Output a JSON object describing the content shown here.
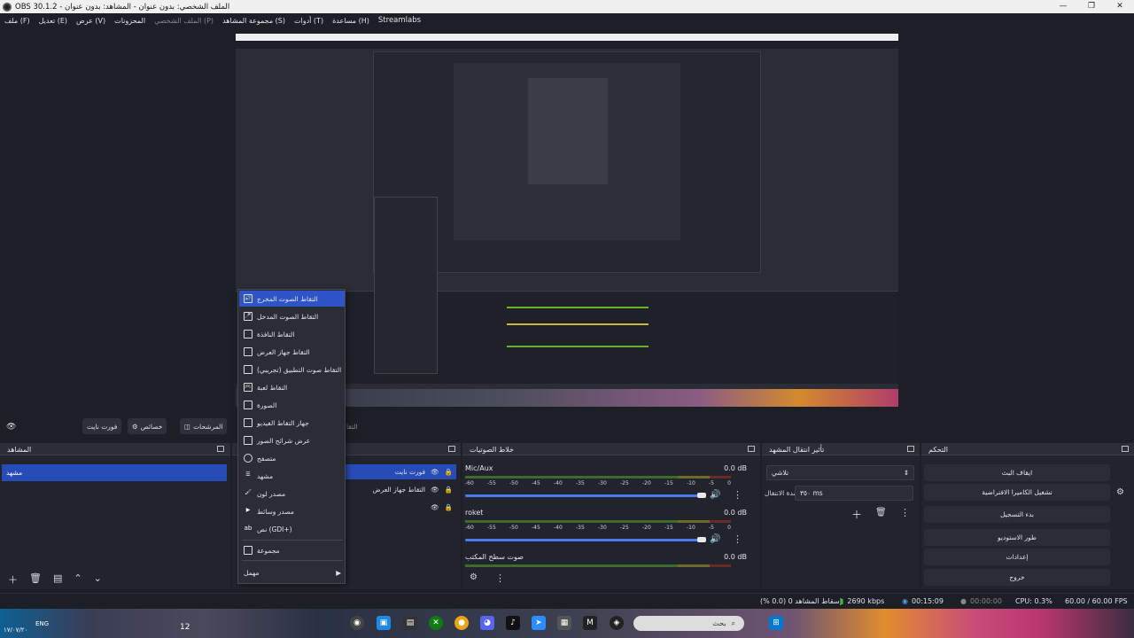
{
  "window": {
    "title": "OBS 30.1.2 - الملف الشخصي: بدون عنوان - المشاهد: بدون عنوان",
    "minimize": "—",
    "maximize": "❐",
    "close": "✕"
  },
  "menubar": {
    "items": [
      "ملف (F)",
      "تعديل (E)",
      "عرض (V)",
      "المحزونات",
      "الملف الشخصي (P)",
      "مجموعة المشاهد (S)",
      "أدوات (T)",
      "مساعدة (H)",
      "Streamlabs"
    ]
  },
  "toolbar": {
    "filters_label": "المرشحات",
    "properties_label": "خصائص",
    "source_name": "فورت نايت",
    "capture_label": "التقا"
  },
  "docks": {
    "scenes_title": "المشاهد",
    "mixer_title": "خلاط الصوتيات",
    "transitions_title": "تأثير انتقال المشهد",
    "controls_title": "التحكم"
  },
  "scenes": {
    "items": [
      "مشهد"
    ]
  },
  "sources": {
    "items": [
      {
        "label": "فورت نايت",
        "selected": true
      },
      {
        "label": "التقاط جهاز العرض",
        "selected": false
      },
      {
        "label": "",
        "selected": false
      }
    ]
  },
  "context_menu": {
    "items": [
      {
        "label": "التقاط الصوت المخرج",
        "icon": "speaker-icon",
        "glyph": "🔊"
      },
      {
        "label": "التقاط الصوت المدخل",
        "icon": "microphone-icon",
        "glyph": "🎤"
      },
      {
        "label": "التقاط النافذة",
        "icon": "window-icon",
        "glyph": ""
      },
      {
        "label": "التقاط جهاز العرض",
        "icon": "monitor-icon",
        "glyph": ""
      },
      {
        "label": "التقاط صوت التطبيق (تجريبي)",
        "icon": "app-audio-icon",
        "glyph": ""
      },
      {
        "label": "التقاط لعبة",
        "icon": "gamepad-icon",
        "glyph": "🎮"
      },
      {
        "label": "الصورة",
        "icon": "image-icon",
        "glyph": ""
      },
      {
        "label": "جهاز التقاط الفيديو",
        "icon": "camera-icon",
        "glyph": ""
      },
      {
        "label": "عرض شرائح الصور",
        "icon": "slideshow-icon",
        "glyph": ""
      },
      {
        "label": "متصفح",
        "icon": "globe-icon",
        "glyph": ""
      },
      {
        "label": "مشهد",
        "icon": "list-icon",
        "glyph": "☰"
      },
      {
        "label": "مصدر لون",
        "icon": "brush-icon",
        "glyph": "🖌"
      },
      {
        "label": "مصدر وسائط",
        "icon": "play-icon",
        "glyph": "▶"
      },
      {
        "label": "نص (GDI+)",
        "icon": "text-icon",
        "glyph": "ab"
      },
      {
        "label": "مجموعة",
        "icon": "folder-icon",
        "glyph": ""
      },
      {
        "label": "مهمل",
        "icon": "",
        "glyph": ""
      }
    ],
    "submenu_arrow": "▶"
  },
  "mixer": {
    "scale": [
      "-60",
      "-55",
      "-50",
      "-45",
      "-40",
      "-35",
      "-30",
      "-25",
      "-20",
      "-15",
      "-10",
      "-5",
      "0"
    ],
    "channels": [
      {
        "name": "Mic/Aux",
        "db": "0.0 dB"
      },
      {
        "name": "roket",
        "db": "0.0 dB"
      },
      {
        "name": "صوت سطح المكتب",
        "db": "0.0 dB"
      }
    ]
  },
  "transitions": {
    "type": "تلاشي",
    "duration_label": "مدة الانتقال",
    "duration_value": "٣٥٠ ms"
  },
  "controls": {
    "buttons": [
      "ايقاف البث",
      "تشغيل الكاميرا الافتراضية",
      "بدء التسجيل",
      "طور الاستوديو",
      "إعدادات",
      "خروج"
    ]
  },
  "status": {
    "dropped_frames": "إسقاط المشاهد 0 (0.0 %)",
    "bitrate": "2690 kbps",
    "stream_time": "00:15:09",
    "rec_time": "00:00:00",
    "cpu": "CPU: 0.3%",
    "fps": "60.00 / 60.00 FPS"
  },
  "taskbar": {
    "search_placeholder": "بحث",
    "date": "١٧/٠٧/٢٠",
    "lang": "ENG",
    "time": "12"
  },
  "colors": {
    "accent": "#284cb7",
    "background": "#1d1f26",
    "panel": "#22242d"
  }
}
